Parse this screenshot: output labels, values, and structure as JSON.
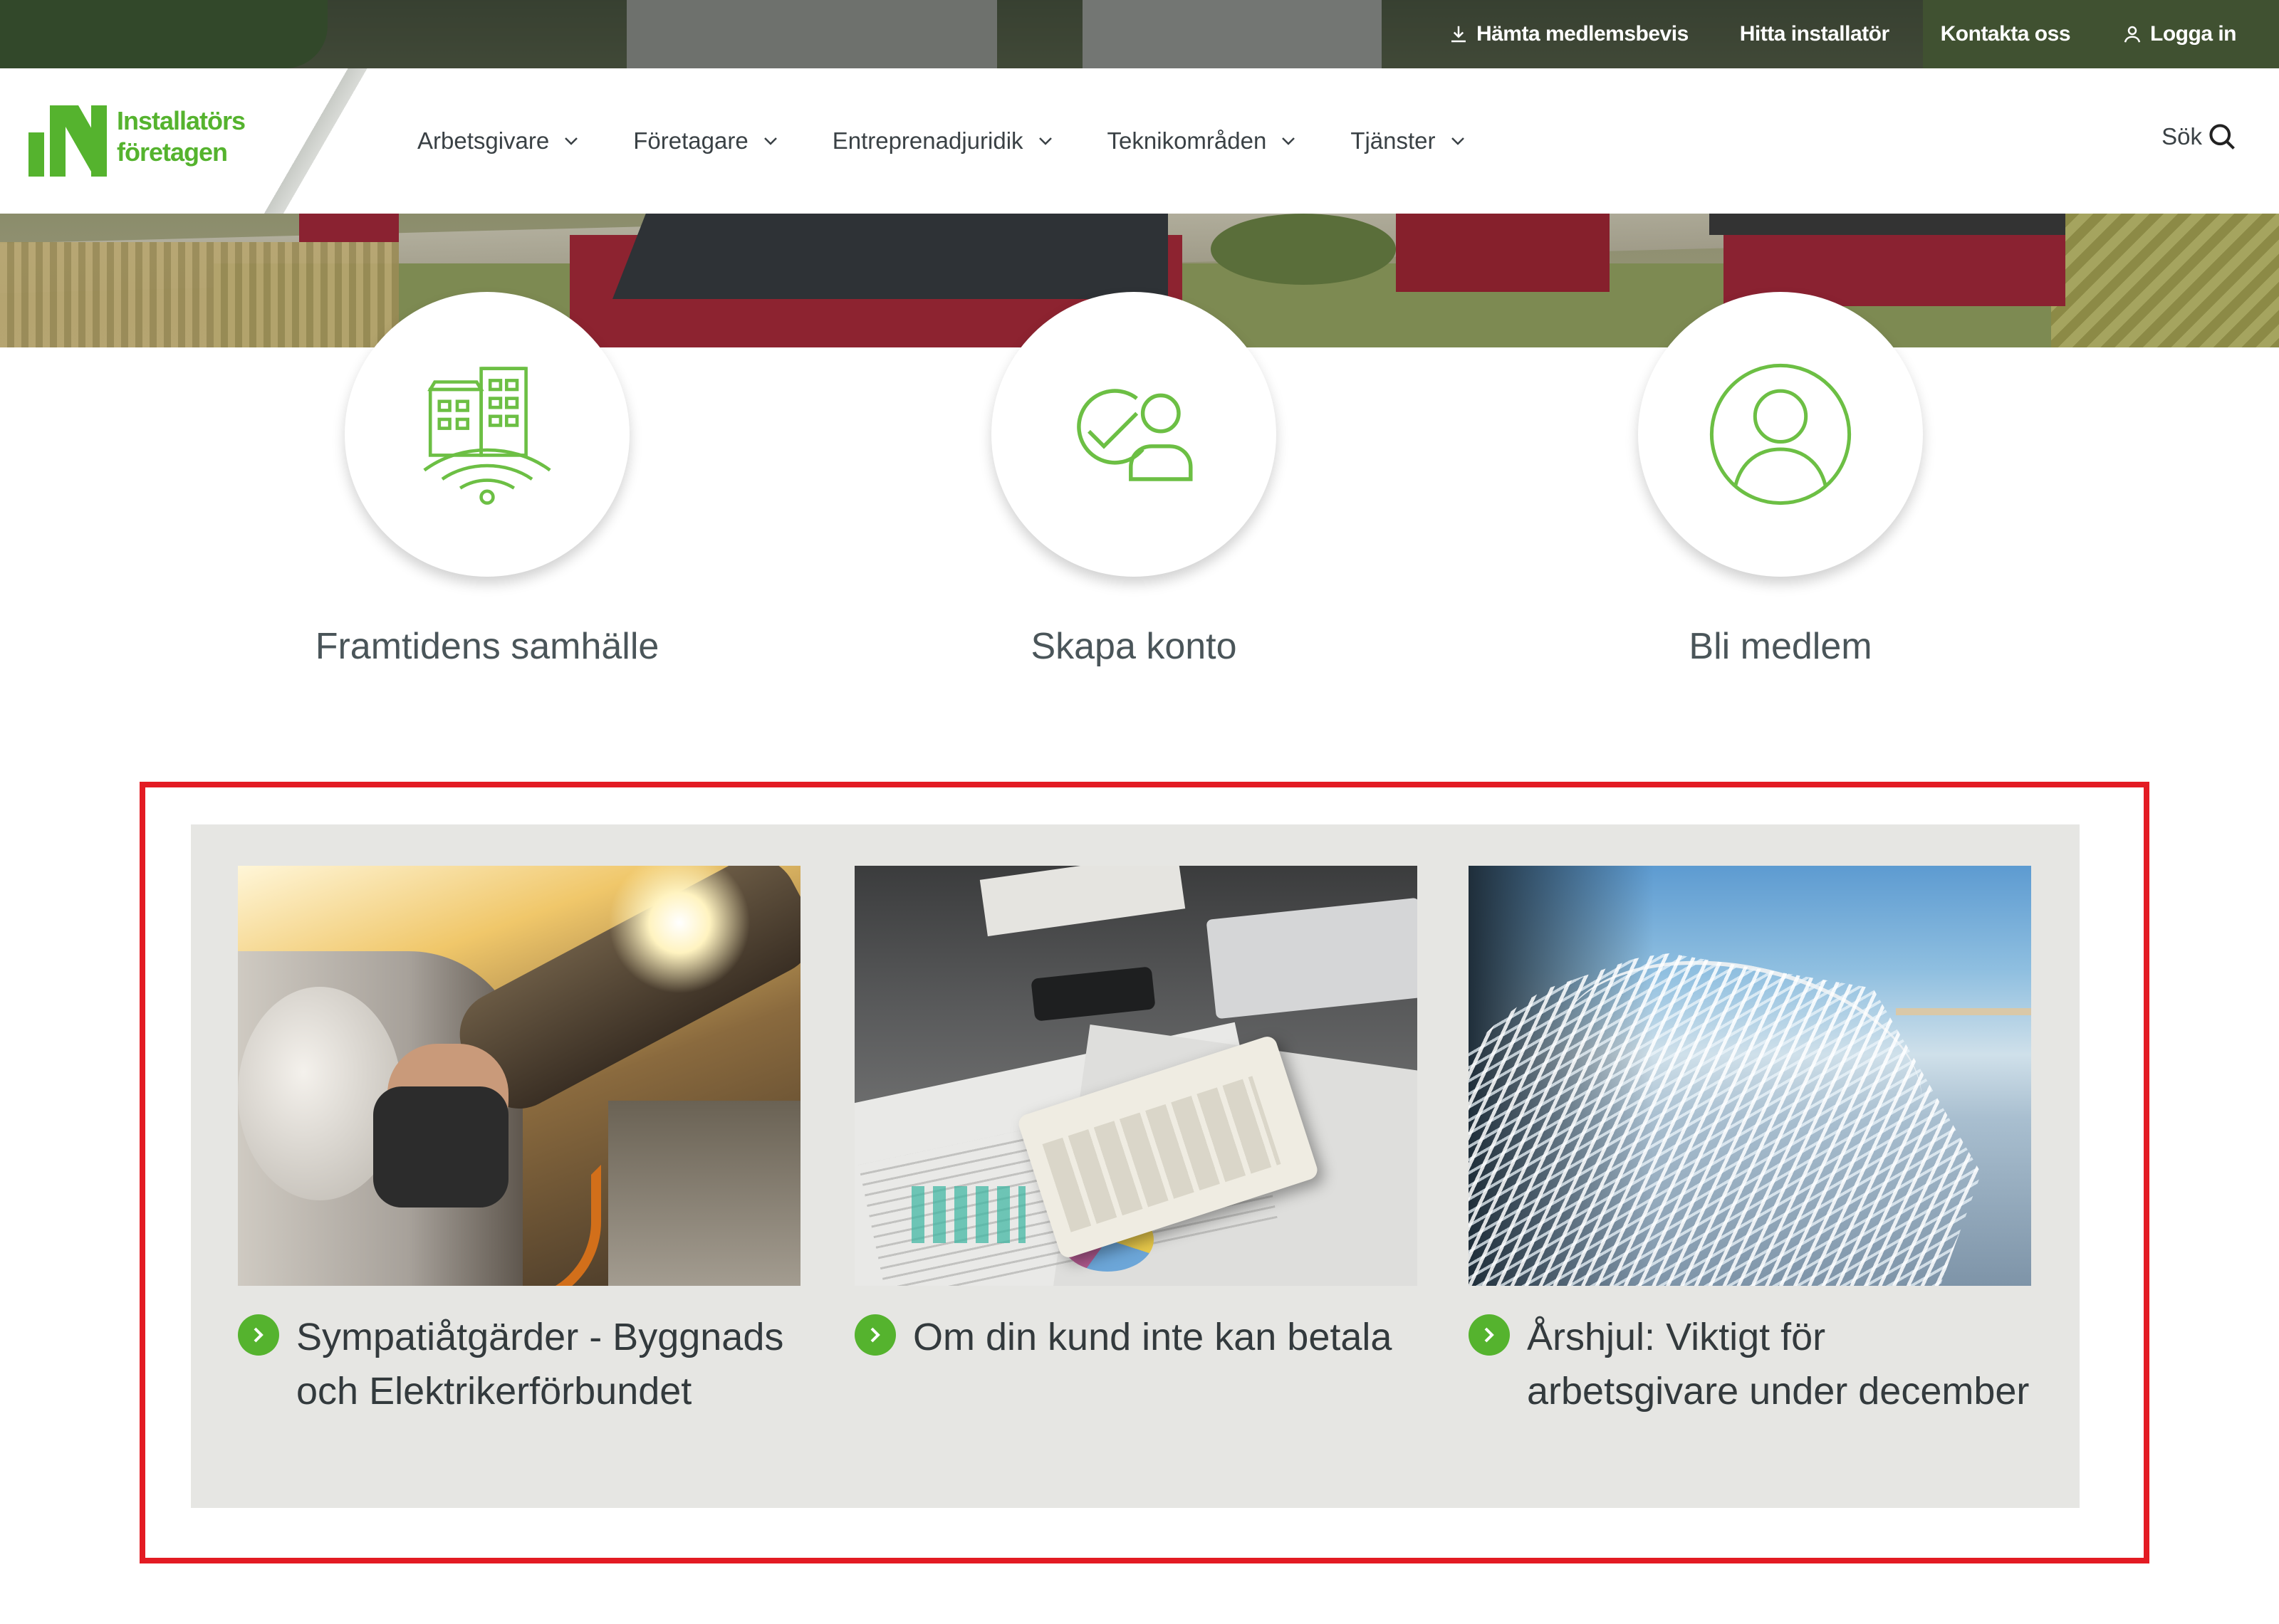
{
  "utility_bar": {
    "items": [
      {
        "label": "Hämta medlemsbevis",
        "icon": "download-icon"
      },
      {
        "label": "Hitta installatör"
      },
      {
        "label": "Kontakta oss"
      },
      {
        "label": "Logga in",
        "icon": "user-icon"
      }
    ]
  },
  "logo": {
    "line1": "Installatörs",
    "line2": "företagen",
    "color": "#55b32e"
  },
  "nav": {
    "items": [
      {
        "label": "Arbetsgivare",
        "icon": "chevron-down-icon"
      },
      {
        "label": "Företagare",
        "icon": "chevron-down-icon"
      },
      {
        "label": "Entreprenadjuridik",
        "icon": "chevron-down-icon"
      },
      {
        "label": "Teknikområden",
        "icon": "chevron-down-icon"
      },
      {
        "label": "Tjänster",
        "icon": "chevron-down-icon"
      }
    ],
    "search_label": "Sök",
    "search_icon": "search-icon"
  },
  "quick_links": [
    {
      "label": "Framtidens samhälle",
      "icon": "smart-building-icon"
    },
    {
      "label": "Skapa konto",
      "icon": "verified-user-icon"
    },
    {
      "label": "Bli medlem",
      "icon": "user-circle-icon"
    }
  ],
  "news": {
    "cards": [
      {
        "title": "Sympatiåtgärder - Byggnads och Elektrikerförbundet",
        "image": "ev-charging-photo"
      },
      {
        "title": "Om din kund inte kan betala",
        "image": "calculator-papers-photo"
      },
      {
        "title": "Årshjul: Viktigt för arbetsgivare under december",
        "image": "frosty-grass-photo"
      }
    ],
    "bullet_icon": "arrow-right-circle-icon"
  },
  "colors": {
    "brand_green": "#55b32e",
    "highlight_red": "#e31b23",
    "panel_grey": "#e6e6e3",
    "text_dark": "#333a3d"
  }
}
